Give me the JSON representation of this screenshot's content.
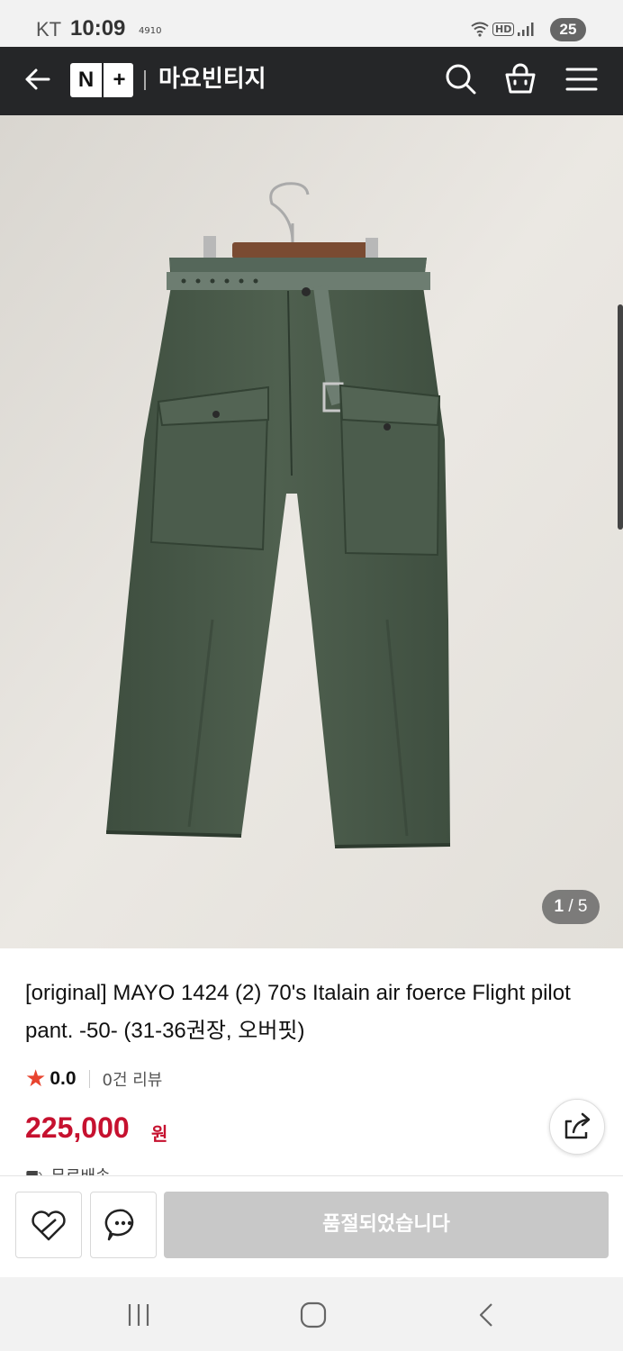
{
  "status_bar": {
    "carrier": "KT",
    "time": "10:09",
    "tiny_label": "4910",
    "network": "HD",
    "battery": "25"
  },
  "header": {
    "logo_n": "N",
    "logo_plus": "+",
    "store_name": "마요빈티지"
  },
  "gallery": {
    "current": "1",
    "separator": " / ",
    "total": "5"
  },
  "product": {
    "title": "[original] MAYO 1424 (2) 70's Italain air foerce Flight pilot pant. -50- (31-36권장, 오버핏)",
    "rating": "0.0",
    "review_count": "0건 리뷰",
    "price": "225,000",
    "currency": "원",
    "shipping": "무료배송"
  },
  "actions": {
    "soldout_label": "품절되었습니다"
  },
  "colors": {
    "app_bar": "#252628",
    "price": "#c6112f",
    "star": "#e8442f",
    "pants": "#4a5a4a"
  }
}
